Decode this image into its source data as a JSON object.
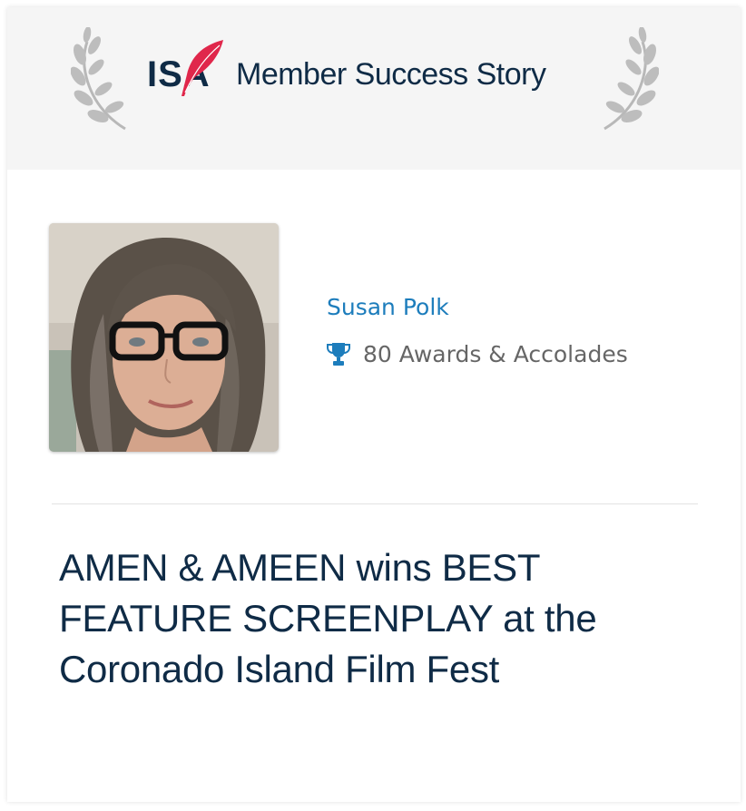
{
  "header": {
    "logo_text": "ISA",
    "title": "Member Success Story"
  },
  "member": {
    "name": "Susan Polk",
    "awards": "80 Awards & Accolades"
  },
  "story": {
    "headline": "AMEN & AMEEN wins BEST FEATURE SCREENPLAY at the Coronado Island Film Fest"
  },
  "colors": {
    "navy": "#0f2b46",
    "link_blue": "#1d7dbc",
    "logo_red": "#e0274b",
    "header_bg": "#f5f5f5"
  },
  "icons": [
    "laurel-wreath-icon",
    "quill-feather-icon",
    "trophy-icon"
  ]
}
